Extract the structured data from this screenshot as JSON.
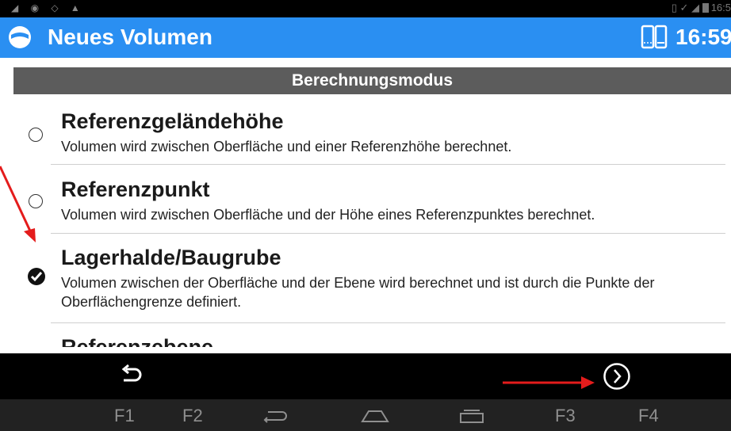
{
  "status_bar": {
    "time": "16:5"
  },
  "app_bar": {
    "title": "Neues Volumen",
    "clock": "16:59"
  },
  "section": {
    "header": "Berechnungsmodus"
  },
  "options": [
    {
      "title": "Referenzgeländehöhe",
      "description": "Volumen wird zwischen Oberfläche und einer Referenzhöhe berechnet.",
      "selected": false
    },
    {
      "title": "Referenzpunkt",
      "description": "Volumen wird zwischen Oberfläche und der Höhe eines Referenzpunktes berechnet.",
      "selected": false
    },
    {
      "title": "Lagerhalde/Baugrube",
      "description": "Volumen zwischen der Oberfläche und der Ebene wird berechnet und ist durch die Punkte der Oberflächengrenze definiert.",
      "selected": true
    },
    {
      "title": "Referenzebene",
      "description": "",
      "selected": false
    }
  ],
  "function_keys": {
    "f1": "F1",
    "f2": "F2",
    "f3": "F3",
    "f4": "F4"
  },
  "colors": {
    "app_bar": "#2a8ff2",
    "section_header": "#5c5c5c",
    "annotation_arrow": "#e41c1c"
  },
  "icons": [
    "app-logo-icon",
    "device-icon",
    "back-arrow-icon",
    "next-circle-icon",
    "nav-back-icon",
    "nav-home-icon",
    "nav-recents-icon"
  ]
}
